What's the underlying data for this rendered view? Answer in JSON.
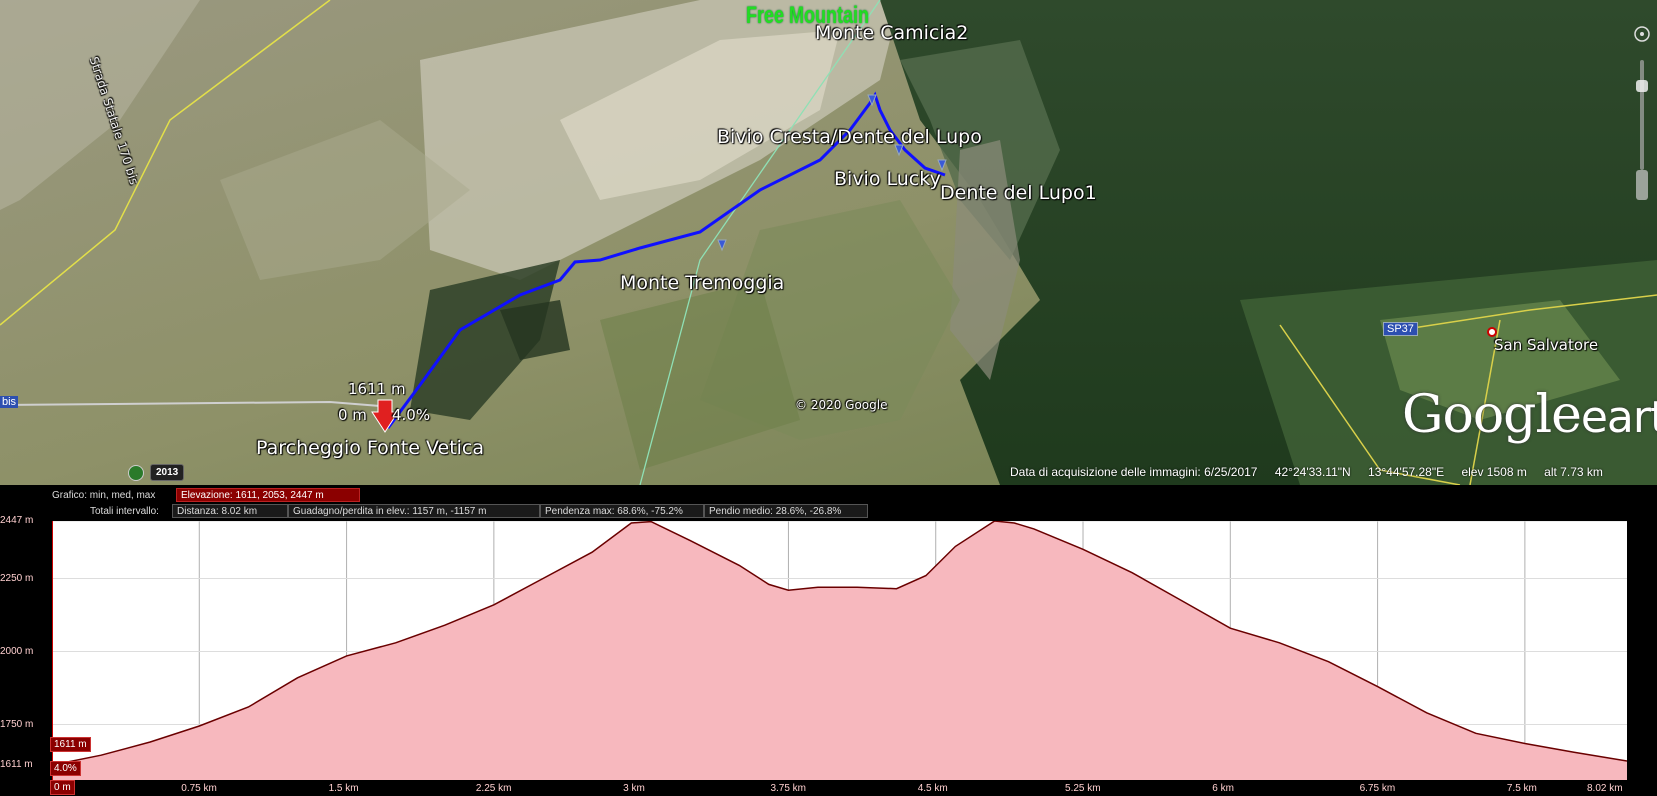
{
  "map": {
    "brand": "Free Mountain",
    "places": {
      "monte_camicia": "Monte Camicia2",
      "bivio_cresta": "Bivio Cresta/Dente del Lupo",
      "bivio_lucky": "Bivio Lucky",
      "dente_lupo": "Dente del Lupo1",
      "monte_tremoggia": "Monte Tremoggia",
      "parcheggio": "Parcheggio Fonte Vetica",
      "san_salvatore": "San Salvatore",
      "road_vertical": "Strada Statale 170 bis"
    },
    "road_shield_sp37": "SP37",
    "road_shield_left": "bis",
    "copyright": "© 2020 Google",
    "logo_google": "Google",
    "logo_earth": "earth",
    "badge_year": "2013",
    "cursor": {
      "elevation": "1611 m",
      "distance": "0 m",
      "slope": "4.0%"
    },
    "track_color": "#1010ff"
  },
  "status": {
    "acquisition": "Data di acquisizione delle immagini: 6/25/2017",
    "lat": "42°24'33.11\"N",
    "lon": "13°44'57.28\"E",
    "elev": "elev  1508 m",
    "alt": "alt   7.73 km"
  },
  "profile_header": {
    "graph_label": "Grafico: min, med, max",
    "elevation": "Elevazione: 1611, 2053, 2447 m",
    "totals_label": "Totali intervallo:",
    "distance": "Distanza: 8.02 km",
    "gain_loss": "Guadagno/perdita in elev.: 1157 m, -1157 m",
    "max_slope": "Pendenza max: 68.6%, -75.2%",
    "avg_slope": "Pendio medio: 28.6%, -26.8%"
  },
  "profile_markers": {
    "elevation": "1611 m",
    "slope": "4.0%",
    "distance": "0 m"
  },
  "chart_data": {
    "type": "area",
    "xlabel": "",
    "ylabel": "",
    "x_tick_labels": [
      "0 m",
      "0.75 km",
      "1.5 km",
      "2.25 km",
      "3 km",
      "3.75 km",
      "4.5 km",
      "5.25 km",
      "6 km",
      "6.75 km",
      "7.5 km",
      "8.02 km"
    ],
    "y_tick_labels": [
      "2447 m",
      "2250 m",
      "2000 m",
      "1750 m",
      "1611 m"
    ],
    "xlim": [
      0,
      8.02
    ],
    "ylim": [
      1560,
      2447
    ],
    "x": [
      0,
      0.25,
      0.5,
      0.75,
      1.0,
      1.25,
      1.5,
      1.75,
      2.0,
      2.25,
      2.5,
      2.75,
      2.95,
      3.05,
      3.25,
      3.5,
      3.65,
      3.75,
      3.9,
      4.1,
      4.3,
      4.45,
      4.6,
      4.8,
      4.9,
      5.0,
      5.25,
      5.5,
      5.75,
      6.0,
      6.25,
      6.5,
      6.75,
      7.0,
      7.25,
      7.5,
      7.75,
      8.02
    ],
    "y": [
      1611,
      1645,
      1690,
      1745,
      1810,
      1910,
      1985,
      2030,
      2090,
      2160,
      2250,
      2340,
      2440,
      2445,
      2380,
      2295,
      2230,
      2210,
      2220,
      2220,
      2215,
      2260,
      2360,
      2447,
      2440,
      2420,
      2350,
      2270,
      2175,
      2080,
      2030,
      1965,
      1880,
      1790,
      1720,
      1685,
      1655,
      1625
    ],
    "fill_color": "#f7b8be",
    "line_color": "#6a0000",
    "grid": true
  }
}
